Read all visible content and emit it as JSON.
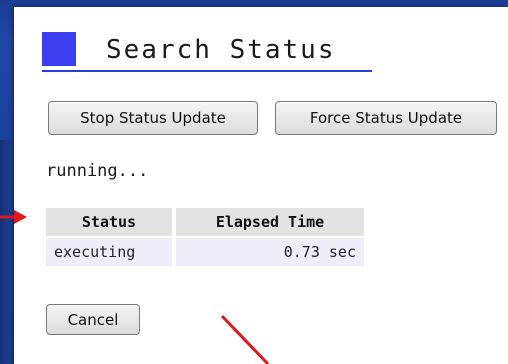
{
  "title": "Search Status",
  "buttons": {
    "stop": "Stop Status Update",
    "force": "Force Status Update",
    "cancel": "Cancel"
  },
  "status_message": "running...",
  "table": {
    "headers": [
      "Status",
      "Elapsed Time"
    ],
    "rows": [
      {
        "status": "executing",
        "elapsed": "0.73 sec"
      }
    ]
  },
  "colors": {
    "background": "#1c3f96",
    "title_square": "#3d3ef0",
    "title_underline": "#2a3fd6",
    "arrow": "#e01818"
  },
  "icons": {
    "title_marker": "square",
    "annotation_arrows": "arrow"
  }
}
